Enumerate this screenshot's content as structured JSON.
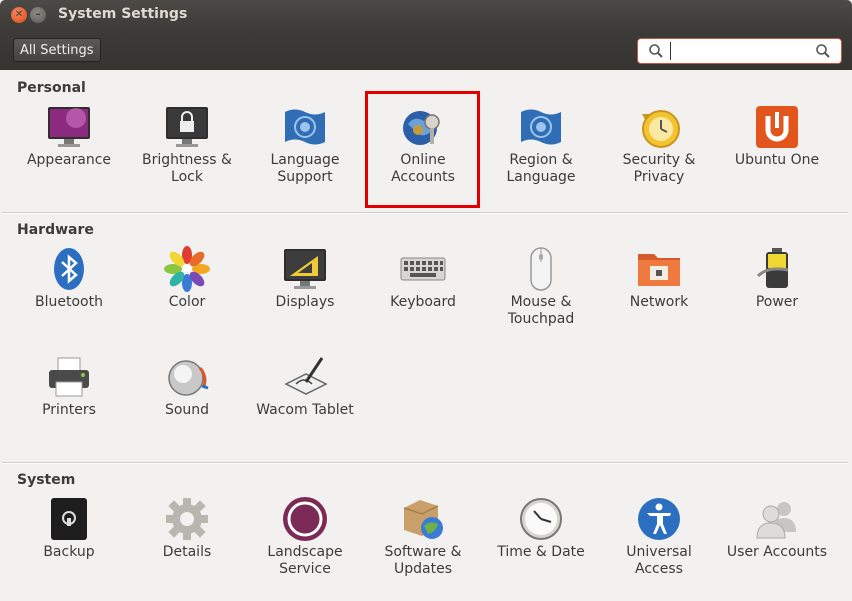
{
  "window": {
    "title": "System Settings"
  },
  "toolbar": {
    "all_settings_label": "All Settings",
    "search_value": "",
    "search_placeholder": ""
  },
  "sections": [
    {
      "title": "Personal",
      "items": [
        {
          "label": "Appearance",
          "icon": "appearance-icon"
        },
        {
          "label": "Brightness &\nLock",
          "icon": "brightness-lock-icon"
        },
        {
          "label": "Language\nSupport",
          "icon": "language-support-icon"
        },
        {
          "label": "Online\nAccounts",
          "icon": "online-accounts-icon"
        },
        {
          "label": "Region &\nLanguage",
          "icon": "region-language-icon"
        },
        {
          "label": "Security &\nPrivacy",
          "icon": "security-privacy-icon"
        },
        {
          "label": "Ubuntu One",
          "icon": "ubuntu-one-icon"
        }
      ]
    },
    {
      "title": "Hardware",
      "items": [
        {
          "label": "Bluetooth",
          "icon": "bluetooth-icon"
        },
        {
          "label": "Color",
          "icon": "color-icon"
        },
        {
          "label": "Displays",
          "icon": "displays-icon"
        },
        {
          "label": "Keyboard",
          "icon": "keyboard-icon"
        },
        {
          "label": "Mouse &\nTouchpad",
          "icon": "mouse-touchpad-icon"
        },
        {
          "label": "Network",
          "icon": "network-icon"
        },
        {
          "label": "Power",
          "icon": "power-icon"
        },
        {
          "label": "Printers",
          "icon": "printers-icon"
        },
        {
          "label": "Sound",
          "icon": "sound-icon"
        },
        {
          "label": "Wacom Tablet",
          "icon": "wacom-tablet-icon"
        }
      ]
    },
    {
      "title": "System",
      "items": [
        {
          "label": "Backup",
          "icon": "backup-icon"
        },
        {
          "label": "Details",
          "icon": "details-icon"
        },
        {
          "label": "Landscape\nService",
          "icon": "landscape-service-icon"
        },
        {
          "label": "Software &\nUpdates",
          "icon": "software-updates-icon"
        },
        {
          "label": "Time & Date",
          "icon": "time-date-icon"
        },
        {
          "label": "Universal\nAccess",
          "icon": "universal-access-icon"
        },
        {
          "label": "User Accounts",
          "icon": "user-accounts-icon"
        }
      ]
    }
  ],
  "colors": {
    "accent": "#dd4814",
    "highlight": "#e00000",
    "titlebar": "#3c3b37"
  }
}
